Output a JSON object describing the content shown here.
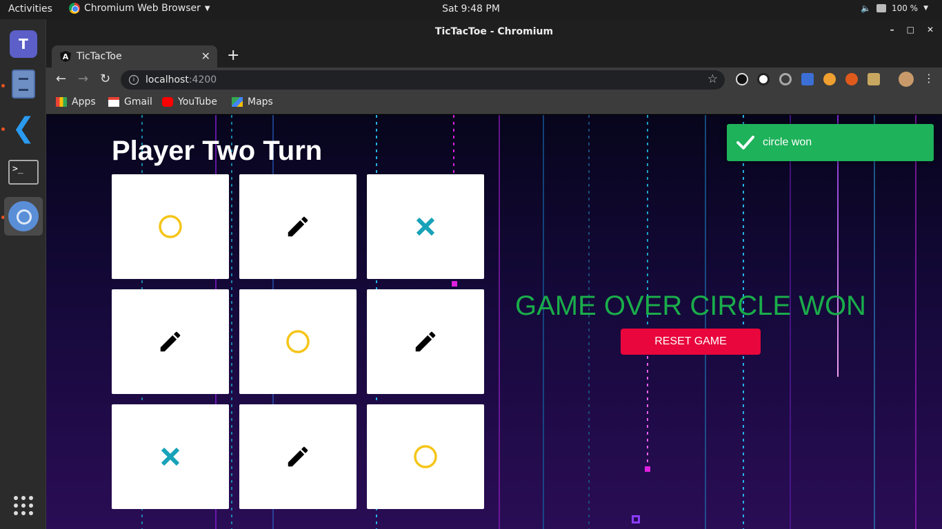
{
  "topbar": {
    "activities": "Activities",
    "app_name": "Chromium Web Browser",
    "clock": "Sat  9:48 PM",
    "battery": "100 %"
  },
  "dock": {
    "teams_letter": "T",
    "terminal_prompt": ">_"
  },
  "window": {
    "title": "TicTacToe - Chromium",
    "minimize": "–",
    "maximize": "□",
    "close": "✕"
  },
  "tab": {
    "title": "TicTacToe",
    "close": "✕",
    "new_tab": "+"
  },
  "toolbar": {
    "url_host": "localhost",
    "url_port": ":4200"
  },
  "bookmarks": [
    {
      "label": "Apps",
      "icon": "apps-icon"
    },
    {
      "label": "Gmail",
      "icon": "gmail-icon"
    },
    {
      "label": "YouTube",
      "icon": "youtube-icon"
    },
    {
      "label": "Maps",
      "icon": "maps-icon"
    }
  ],
  "game": {
    "turn_text": "Player Two Turn",
    "board": [
      "circle",
      "pencil",
      "cross",
      "pencil",
      "circle",
      "pencil",
      "cross",
      "pencil",
      "circle"
    ],
    "game_over_text": "GAME OVER CIRCLE WON",
    "reset_label": "RESET GAME",
    "toast_text": "circle won"
  },
  "colors": {
    "circle": "#f5c518",
    "cross": "#17a2b8",
    "game_over": "#1aad4a",
    "reset_button": "#e8063c",
    "toast": "#1eb25a"
  }
}
